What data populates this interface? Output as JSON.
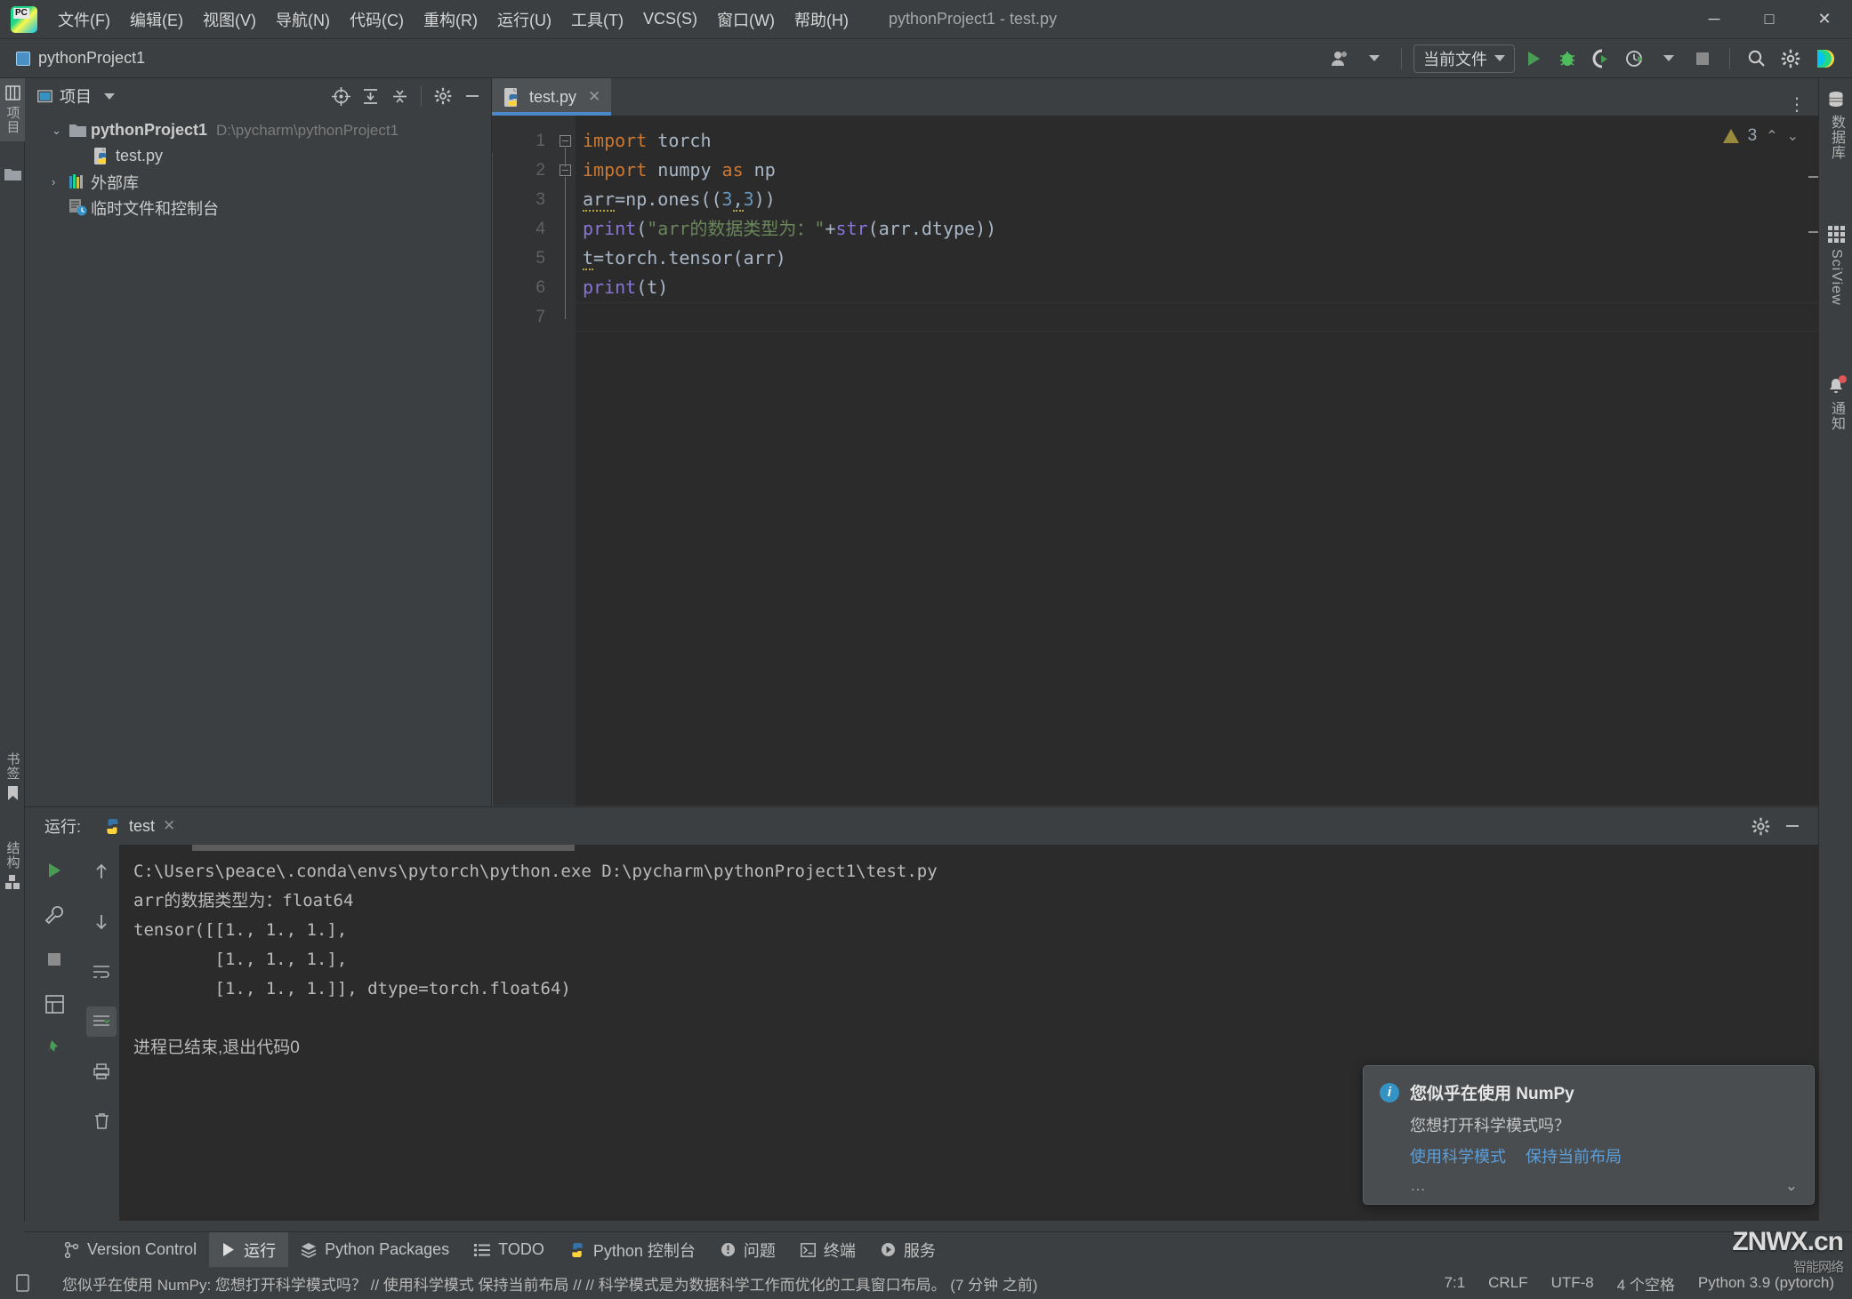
{
  "window": {
    "title": "pythonProject1 - test.py",
    "minimize": "─",
    "maximize": "□",
    "close": "✕"
  },
  "menu": [
    {
      "label": "文件(F)",
      "name": "menu-file"
    },
    {
      "label": "编辑(E)",
      "name": "menu-edit"
    },
    {
      "label": "视图(V)",
      "name": "menu-view"
    },
    {
      "label": "导航(N)",
      "name": "menu-navigate"
    },
    {
      "label": "代码(C)",
      "name": "menu-code"
    },
    {
      "label": "重构(R)",
      "name": "menu-refactor"
    },
    {
      "label": "运行(U)",
      "name": "menu-run"
    },
    {
      "label": "工具(T)",
      "name": "menu-tools"
    },
    {
      "label": "VCS(S)",
      "name": "menu-vcs"
    },
    {
      "label": "窗口(W)",
      "name": "menu-window"
    },
    {
      "label": "帮助(H)",
      "name": "menu-help"
    }
  ],
  "navbar": {
    "project_name": "pythonProject1",
    "run_config": "当前文件"
  },
  "left_tool_tabs": [
    {
      "label": "项目",
      "name": "sidebar-tab-project",
      "active": true
    },
    {
      "label": "书签",
      "name": "sidebar-tab-bookmarks",
      "active": false
    },
    {
      "label": "结构",
      "name": "sidebar-tab-structure",
      "active": false
    }
  ],
  "right_tool_tabs": [
    {
      "label": "数据库",
      "name": "sidebar-tab-database"
    },
    {
      "label": "SciView",
      "name": "sidebar-tab-sciview"
    },
    {
      "label": "通知",
      "name": "sidebar-tab-notifications"
    }
  ],
  "project_panel": {
    "title": "项目",
    "tree": [
      {
        "label": "pythonProject1",
        "detail": "D:\\pycharm\\pythonProject1",
        "level": 0,
        "expanded": true,
        "icon": "folder-icon",
        "bold": true
      },
      {
        "label": "test.py",
        "detail": "",
        "level": 1,
        "expanded": null,
        "icon": "python-file-icon",
        "bold": false
      },
      {
        "label": "外部库",
        "detail": "",
        "level": 0,
        "expanded": false,
        "icon": "library-icon",
        "bold": false
      },
      {
        "label": "临时文件和控制台",
        "detail": "",
        "level": 0,
        "expanded": null,
        "icon": "scratches-icon",
        "bold": false
      }
    ]
  },
  "editor": {
    "tab_label": "test.py",
    "inspection_count": "3",
    "line_numbers": [
      "1",
      "2",
      "3",
      "4",
      "5",
      "6",
      "7"
    ],
    "code_lines": [
      "import torch",
      "import numpy as np",
      "arr=np.ones((3,3))",
      "print(\"arr的数据类型为：\"+str(arr.dtype))",
      "t=torch.tensor(arr)",
      "print(t)",
      ""
    ]
  },
  "run_panel": {
    "label": "运行:",
    "tab": "test",
    "console_lines": [
      "C:\\Users\\peace\\.conda\\envs\\pytorch\\python.exe D:\\pycharm\\pythonProject1\\test.py",
      "arr的数据类型为：float64",
      "tensor([[1., 1., 1.],",
      "        [1., 1., 1.],",
      "        [1., 1., 1.]], dtype=torch.float64)",
      "",
      "进程已结束,退出代码0"
    ]
  },
  "balloon": {
    "title": "您似乎在使用 NumPy",
    "subtitle": "您想打开科学模式吗？",
    "link_primary": "使用科学模式",
    "link_secondary": "保持当前布局",
    "more": "…"
  },
  "bottom_tabs": [
    {
      "label": "Version Control",
      "name": "tool-tab-version-control",
      "active": false,
      "icon": "branch-icon"
    },
    {
      "label": "运行",
      "name": "tool-tab-run",
      "active": true,
      "icon": "play-icon"
    },
    {
      "label": "Python Packages",
      "name": "tool-tab-python-packages",
      "active": false,
      "icon": "packages-icon"
    },
    {
      "label": "TODO",
      "name": "tool-tab-todo",
      "active": false,
      "icon": "list-icon"
    },
    {
      "label": "Python 控制台",
      "name": "tool-tab-python-console",
      "active": false,
      "icon": "python-icon"
    },
    {
      "label": "问题",
      "name": "tool-tab-problems",
      "active": false,
      "icon": "error-icon"
    },
    {
      "label": "终端",
      "name": "tool-tab-terminal",
      "active": false,
      "icon": "terminal-icon"
    },
    {
      "label": "服务",
      "name": "tool-tab-services",
      "active": false,
      "icon": "services-icon"
    }
  ],
  "statusbar": {
    "message": "您似乎在使用 NumPy: 您想打开科学模式吗？ // 使用科学模式  保持当前布局 // // 科学模式是为数据科学工作而优化的工具窗口布局。 (7 分钟 之前)",
    "caret": "7:1",
    "line_sep": "CRLF",
    "encoding": "UTF-8",
    "indent": "4 个空格",
    "interpreter": "Python 3.9 (pytorch)"
  },
  "watermark": {
    "text": "ZNWX.cn",
    "sub": "智能网络"
  },
  "colors": {
    "bg_panel": "#3c3f41",
    "bg_editor": "#2b2b2b",
    "accent_blue": "#4a88c7",
    "link_blue": "#5e9ed6",
    "keyword_orange": "#cc7832",
    "string_green": "#6a8759",
    "number_blue": "#6897bb",
    "function_purple": "#8a74d6",
    "run_green": "#499c54"
  }
}
